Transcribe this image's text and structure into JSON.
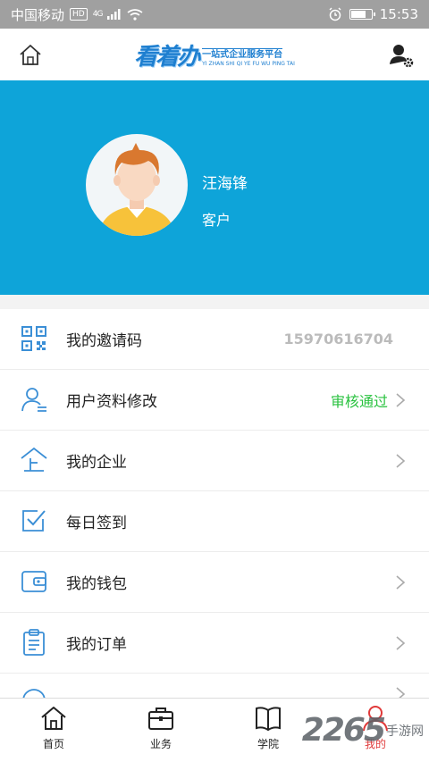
{
  "status_bar": {
    "carrier": "中国移动",
    "hd_badge": "HD",
    "network": "4G",
    "time": "15:53",
    "battery_level": 0.75
  },
  "header": {
    "logo_main": "看着办",
    "logo_sub_cn": "一站式企业服务平台",
    "logo_sub_pinyin": "YI ZHAN SHI QI YE FU WU PING TAI"
  },
  "profile": {
    "name": "汪海锋",
    "role": "客户"
  },
  "menu": [
    {
      "label": "我的邀请码",
      "value": "15970616704",
      "icon": "qrcode-icon",
      "chevron": false
    },
    {
      "label": "用户资料修改",
      "value": "审核通过",
      "icon": "user-profile-icon",
      "chevron": true
    },
    {
      "label": "我的企业",
      "value": "",
      "icon": "enterprise-icon",
      "chevron": true
    },
    {
      "label": "每日签到",
      "value": "",
      "icon": "checkin-icon",
      "chevron": false
    },
    {
      "label": "我的钱包",
      "value": "",
      "icon": "wallet-icon",
      "chevron": true
    },
    {
      "label": "我的订单",
      "value": "",
      "icon": "order-icon",
      "chevron": true
    }
  ],
  "tabs": [
    {
      "label": "首页",
      "icon": "home-icon",
      "active": false
    },
    {
      "label": "业务",
      "icon": "briefcase-icon",
      "active": false
    },
    {
      "label": "学院",
      "icon": "book-icon",
      "active": false
    },
    {
      "label": "我的",
      "icon": "person-icon",
      "active": true
    }
  ],
  "watermark": {
    "number": "2265",
    "text": "手游网"
  },
  "colors": {
    "banner": "#0ea4d9",
    "icon_blue": "#3b8fd6",
    "approved_green": "#29c23f",
    "active_tab": "#e03a3a"
  }
}
